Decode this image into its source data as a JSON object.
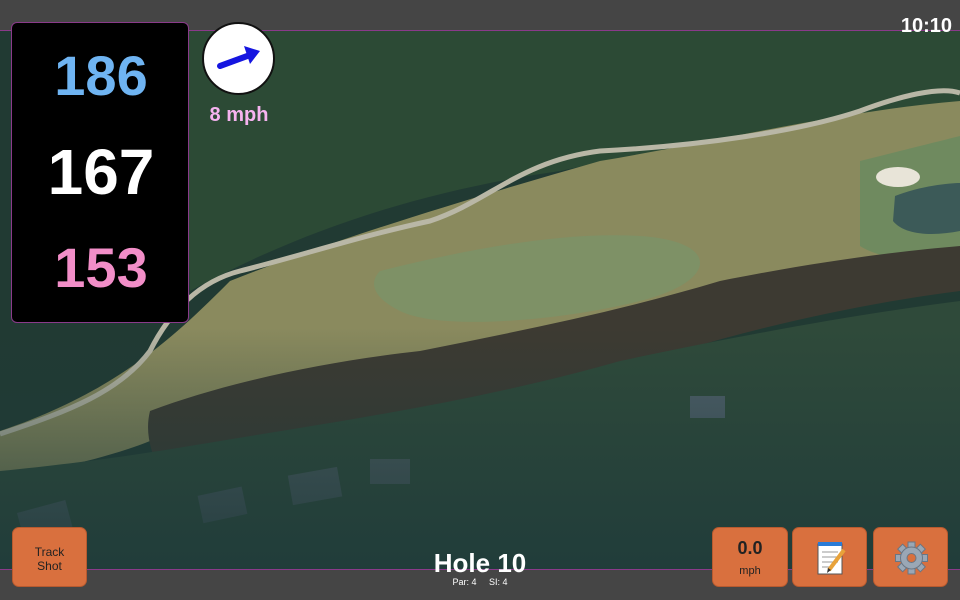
{
  "status_bar": {
    "time": "10:10"
  },
  "yardages": {
    "back": "186",
    "middle": "167",
    "front": "153"
  },
  "wind": {
    "speed_text": "8 mph",
    "arrow_color": "#1515e0"
  },
  "hole": {
    "title": "Hole 10",
    "par_text": "Par: 4",
    "si_text": "SI: 4"
  },
  "buttons": {
    "track_shot_line1": "Track",
    "track_shot_line2": "Shot",
    "speed_value": "0.0",
    "speed_unit": "mph",
    "notes_icon": "notepad-icon",
    "settings_icon": "gear-icon"
  },
  "colors": {
    "button_bg": "#d9703e",
    "back_yardage": "#6fb4f2",
    "middle_yardage": "#ffffff",
    "front_yardage": "#f28ec8",
    "wind_text": "#f6b3f0"
  }
}
